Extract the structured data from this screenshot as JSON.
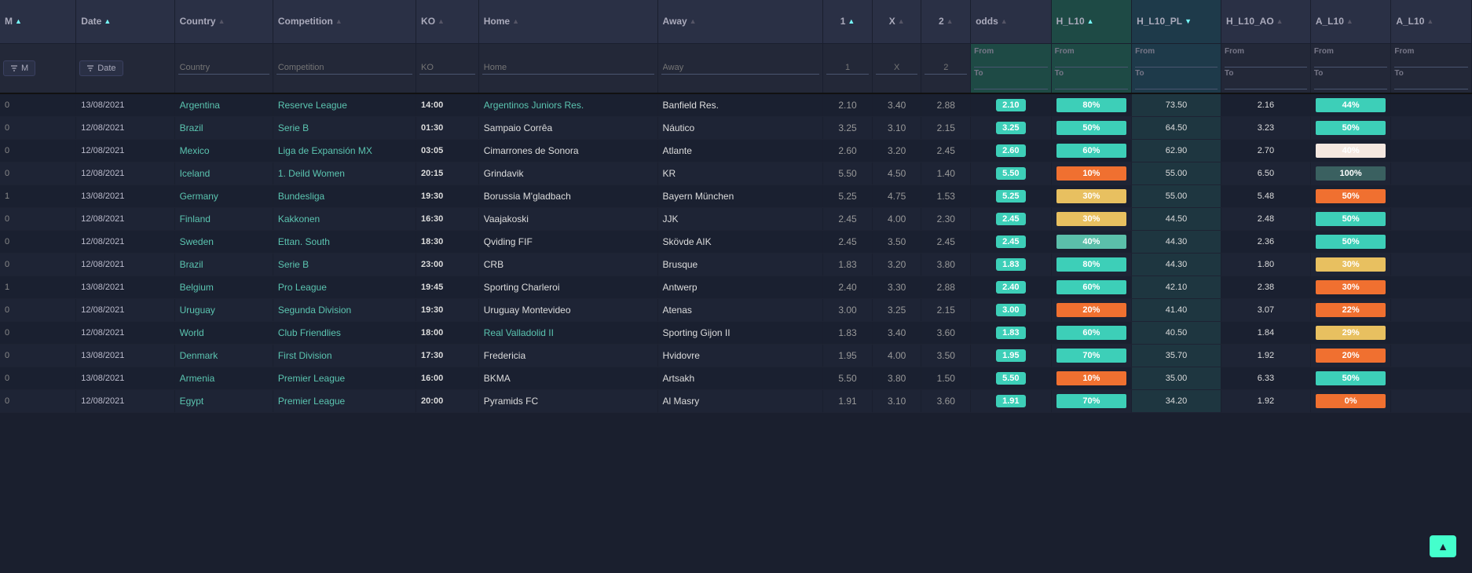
{
  "columns": {
    "m": "M",
    "date": "Date",
    "country": "Country",
    "competition": "Competition",
    "ko": "KO",
    "home": "Home",
    "away": "Away",
    "c1": "1",
    "cx": "X",
    "c2": "2",
    "odds": "odds",
    "hl10": "H_L10",
    "hl10pl": "H_L10_PL",
    "hl10ao": "H_L10_AO",
    "al10": "A_L10",
    "al10x": "A_L10"
  },
  "filter": {
    "m_label": "M",
    "date_label": "Date",
    "country_placeholder": "Country",
    "competition_placeholder": "Competition",
    "ko_placeholder": "KO",
    "home_placeholder": "Home",
    "away_placeholder": "Away",
    "c1_placeholder": "1",
    "cx_placeholder": "X",
    "c2_placeholder": "2",
    "from_label": "From",
    "to_label": "To"
  },
  "rows": [
    {
      "m": "0",
      "date": "13/08/2021",
      "country": "Argentina",
      "competition": "Reserve League",
      "ko": "14:00",
      "home": "Argentinos Juniors Res.",
      "away": "Banfield Res.",
      "c1": "2.10",
      "cx": "3.40",
      "c2": "2.88",
      "odds": "2.10",
      "odds_color": "#3dcfb8",
      "hl10_pct": "80%",
      "hl10_color": "#3dcfb8",
      "hl10pl_val": "73.50",
      "hl10pl_color": "#3dcfb8",
      "hl10ao_val": "2.16",
      "hl10ao_color": "#3dcfb8",
      "al10_pct": "44%",
      "al10_color": "#3dcfb8"
    },
    {
      "m": "0",
      "date": "12/08/2021",
      "country": "Brazil",
      "competition": "Serie B",
      "ko": "01:30",
      "home": "Sampaio Corrêa",
      "away": "Náutico",
      "c1": "3.25",
      "cx": "3.10",
      "c2": "2.15",
      "odds": "3.25",
      "odds_color": "#3dcfb8",
      "hl10_pct": "50%",
      "hl10_color": "#3dcfb8",
      "hl10pl_val": "64.50",
      "hl10pl_color": "#3dcfb8",
      "hl10ao_val": "3.23",
      "hl10ao_color": "#3dcfb8",
      "al10_pct": "50%",
      "al10_color": "#3dcfb8"
    },
    {
      "m": "0",
      "date": "12/08/2021",
      "country": "Mexico",
      "competition": "Liga de Expansión MX",
      "ko": "03:05",
      "home": "Cimarrones de Sonora",
      "away": "Atlante",
      "c1": "2.60",
      "cx": "3.20",
      "c2": "2.45",
      "odds": "2.60",
      "odds_color": "#3dcfb8",
      "hl10_pct": "60%",
      "hl10_color": "#3dcfb8",
      "hl10pl_val": "62.90",
      "hl10pl_color": "#3dcfb8",
      "hl10ao_val": "2.70",
      "hl10ao_color": "#3dcfb8",
      "al10_pct": "40%",
      "al10_color": "#f5e8e0"
    },
    {
      "m": "0",
      "date": "12/08/2021",
      "country": "Iceland",
      "competition": "1. Deild Women",
      "ko": "20:15",
      "home": "Grindavik",
      "away": "KR",
      "c1": "5.50",
      "cx": "4.50",
      "c2": "1.40",
      "odds": "5.50",
      "odds_color": "#3dcfb8",
      "hl10_pct": "10%",
      "hl10_color": "#f07030",
      "hl10pl_val": "55.00",
      "hl10pl_color": "#3dcfb8",
      "hl10ao_val": "6.50",
      "hl10ao_color": "#3dcfb8",
      "al10_pct": "100%",
      "al10_color": "#3a6060"
    },
    {
      "m": "1",
      "date": "13/08/2021",
      "country": "Germany",
      "competition": "Bundesliga",
      "ko": "19:30",
      "home": "Borussia M'gladbach",
      "away": "Bayern München",
      "c1": "5.25",
      "cx": "4.75",
      "c2": "1.53",
      "odds": "5.25",
      "odds_color": "#3dcfb8",
      "hl10_pct": "30%",
      "hl10_color": "#e8c060",
      "hl10pl_val": "55.00",
      "hl10pl_color": "#3dcfb8",
      "hl10ao_val": "5.48",
      "hl10ao_color": "#3dcfb8",
      "al10_pct": "50%",
      "al10_color": "#f07030"
    },
    {
      "m": "0",
      "date": "12/08/2021",
      "country": "Finland",
      "competition": "Kakkonen",
      "ko": "16:30",
      "home": "Vaajakoski",
      "away": "JJK",
      "c1": "2.45",
      "cx": "4.00",
      "c2": "2.30",
      "odds": "2.45",
      "odds_color": "#3dcfb8",
      "hl10_pct": "30%",
      "hl10_color": "#e8c060",
      "hl10pl_val": "44.50",
      "hl10pl_color": "#3dcfb8",
      "hl10ao_val": "2.48",
      "hl10ao_color": "#3dcfb8",
      "al10_pct": "50%",
      "al10_color": "#3dcfb8"
    },
    {
      "m": "0",
      "date": "12/08/2021",
      "country": "Sweden",
      "competition": "Ettan. South",
      "ko": "18:30",
      "home": "Qviding FIF",
      "away": "Skövde AIK",
      "c1": "2.45",
      "cx": "3.50",
      "c2": "2.45",
      "odds": "2.45",
      "odds_color": "#3dcfb8",
      "hl10_pct": "40%",
      "hl10_color": "#5bbfaa",
      "hl10pl_val": "44.30",
      "hl10pl_color": "#3dcfb8",
      "hl10ao_val": "2.36",
      "hl10ao_color": "#3dcfb8",
      "al10_pct": "50%",
      "al10_color": "#3dcfb8"
    },
    {
      "m": "0",
      "date": "12/08/2021",
      "country": "Brazil",
      "competition": "Serie B",
      "ko": "23:00",
      "home": "CRB",
      "away": "Brusque",
      "c1": "1.83",
      "cx": "3.20",
      "c2": "3.80",
      "odds": "1.83",
      "odds_color": "#3dcfb8",
      "hl10_pct": "80%",
      "hl10_color": "#3dcfb8",
      "hl10pl_val": "44.30",
      "hl10pl_color": "#3dcfb8",
      "hl10ao_val": "1.80",
      "hl10ao_color": "#f5ede8",
      "al10_pct": "30%",
      "al10_color": "#e8c060"
    },
    {
      "m": "1",
      "date": "13/08/2021",
      "country": "Belgium",
      "competition": "Pro League",
      "ko": "19:45",
      "home": "Sporting Charleroi",
      "away": "Antwerp",
      "c1": "2.40",
      "cx": "3.30",
      "c2": "2.88",
      "odds": "2.40",
      "odds_color": "#3dcfb8",
      "hl10_pct": "60%",
      "hl10_color": "#3dcfb8",
      "hl10pl_val": "42.10",
      "hl10pl_color": "#3dcfb8",
      "hl10ao_val": "2.38",
      "hl10ao_color": "#3dcfb8",
      "al10_pct": "30%",
      "al10_color": "#f07030"
    },
    {
      "m": "0",
      "date": "12/08/2021",
      "country": "Uruguay",
      "competition": "Segunda Division",
      "ko": "19:30",
      "home": "Uruguay Montevideo",
      "away": "Atenas",
      "c1": "3.00",
      "cx": "3.25",
      "c2": "2.15",
      "odds": "3.00",
      "odds_color": "#3dcfb8",
      "hl10_pct": "20%",
      "hl10_color": "#f07030",
      "hl10pl_val": "41.40",
      "hl10pl_color": "#3dcfb8",
      "hl10ao_val": "3.07",
      "hl10ao_color": "#3dcfb8",
      "al10_pct": "22%",
      "al10_color": "#f07030"
    },
    {
      "m": "0",
      "date": "12/08/2021",
      "country": "World",
      "competition": "Club Friendlies",
      "ko": "18:00",
      "home": "Real Valladolid II",
      "away": "Sporting Gijon II",
      "c1": "1.83",
      "cx": "3.40",
      "c2": "3.60",
      "odds": "1.83",
      "odds_color": "#3dcfb8",
      "hl10_pct": "60%",
      "hl10_color": "#3dcfb8",
      "hl10pl_val": "40.50",
      "hl10pl_color": "#3dcfb8",
      "hl10ao_val": "1.84",
      "hl10ao_color": "#f5ede8",
      "al10_pct": "29%",
      "al10_color": "#e8c060"
    },
    {
      "m": "0",
      "date": "13/08/2021",
      "country": "Denmark",
      "competition": "First Division",
      "ko": "17:30",
      "home": "Fredericia",
      "away": "Hvidovre",
      "c1": "1.95",
      "cx": "4.00",
      "c2": "3.50",
      "odds": "1.95",
      "odds_color": "#3dcfb8",
      "hl10_pct": "70%",
      "hl10_color": "#3dcfb8",
      "hl10pl_val": "35.70",
      "hl10pl_color": "#3dcfb8",
      "hl10ao_val": "1.92",
      "hl10ao_color": "#3dcfb8",
      "al10_pct": "20%",
      "al10_color": "#f07030"
    },
    {
      "m": "0",
      "date": "13/08/2021",
      "country": "Armenia",
      "competition": "Premier League",
      "ko": "16:00",
      "home": "BKMA",
      "away": "Artsakh",
      "c1": "5.50",
      "cx": "3.80",
      "c2": "1.50",
      "odds": "5.50",
      "odds_color": "#3dcfb8",
      "hl10_pct": "10%",
      "hl10_color": "#f07030",
      "hl10pl_val": "35.00",
      "hl10pl_color": "#3dcfb8",
      "hl10ao_val": "6.33",
      "hl10ao_color": "#3dcfb8",
      "al10_pct": "50%",
      "al10_color": "#3dcfb8"
    },
    {
      "m": "0",
      "date": "12/08/2021",
      "country": "Egypt",
      "competition": "Premier League",
      "ko": "20:00",
      "home": "Pyramids FC",
      "away": "Al Masry",
      "c1": "1.91",
      "cx": "3.10",
      "c2": "3.60",
      "odds": "1.91",
      "odds_color": "#3dcfb8",
      "hl10_pct": "70%",
      "hl10_color": "#3dcfb8",
      "hl10pl_val": "34.20",
      "hl10pl_color": "#3dcfb8",
      "hl10ao_val": "1.92",
      "hl10ao_color": "#3dcfb8",
      "al10_pct": "0%",
      "al10_color": "#f07030"
    }
  ],
  "scroll_top_label": "▲"
}
